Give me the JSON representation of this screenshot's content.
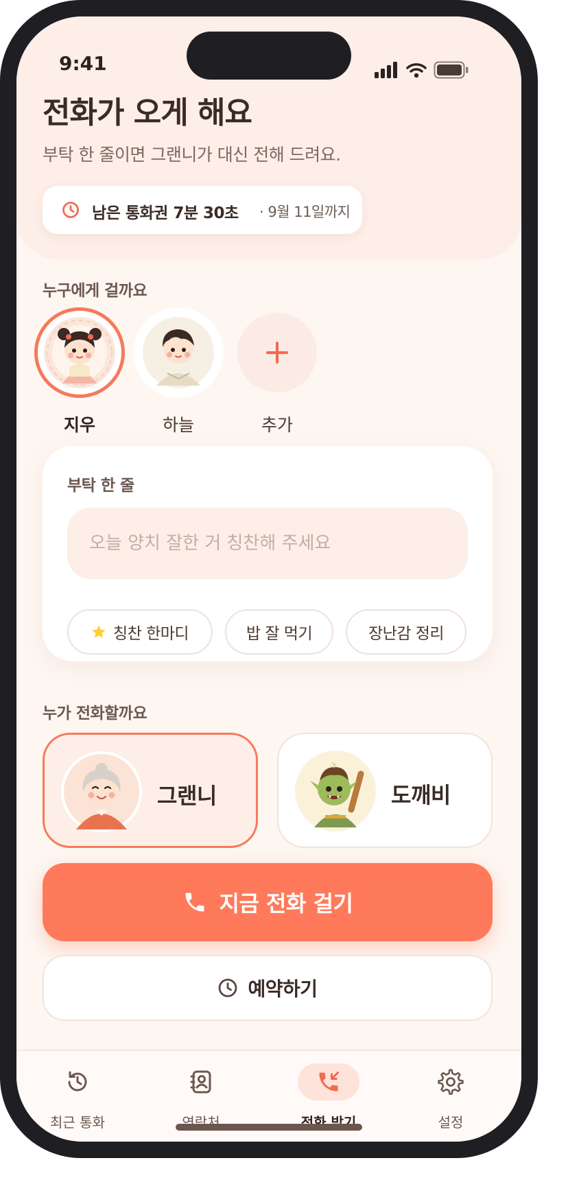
{
  "status_bar": {
    "time": "9:41"
  },
  "header": {
    "title": "전화가 오게 해요",
    "subtitle": "부탁 한 줄이면 그랜니가 대신 전해 드려요."
  },
  "credits": {
    "remaining": "남은 통화권 7분 30초",
    "expiry": "· 9월 11일까지"
  },
  "recipients": {
    "label": "누구에게 걸까요",
    "items": [
      {
        "name": "지우",
        "selected": true
      },
      {
        "name": "하늘",
        "selected": false
      }
    ],
    "add_label": "추가"
  },
  "request": {
    "title": "부탁 한 줄",
    "placeholder": "오늘 양치 잘한 거 칭찬해 주세요",
    "chips": [
      "칭찬 한마디",
      "밥 잘 먹기",
      "장난감 정리"
    ]
  },
  "callers": {
    "label": "누가 전화할까요",
    "items": [
      {
        "name": "그랜니",
        "selected": true
      },
      {
        "name": "도깨비",
        "selected": false
      }
    ]
  },
  "actions": {
    "call_now": "지금 전화 걸기",
    "schedule": "예약하기"
  },
  "tab_bar": {
    "items": [
      {
        "label": "최근 통화",
        "icon": "history-icon",
        "active": false
      },
      {
        "label": "연락처",
        "icon": "contacts-icon",
        "active": false
      },
      {
        "label": "전화 받기",
        "icon": "incoming-call-icon",
        "active": true
      },
      {
        "label": "설정",
        "icon": "gear-icon",
        "active": false
      }
    ]
  },
  "colors": {
    "accent": "#ff7a5a",
    "background": "#fdf6f1",
    "hero": "#fdeee8",
    "text": "#3a2b25"
  }
}
